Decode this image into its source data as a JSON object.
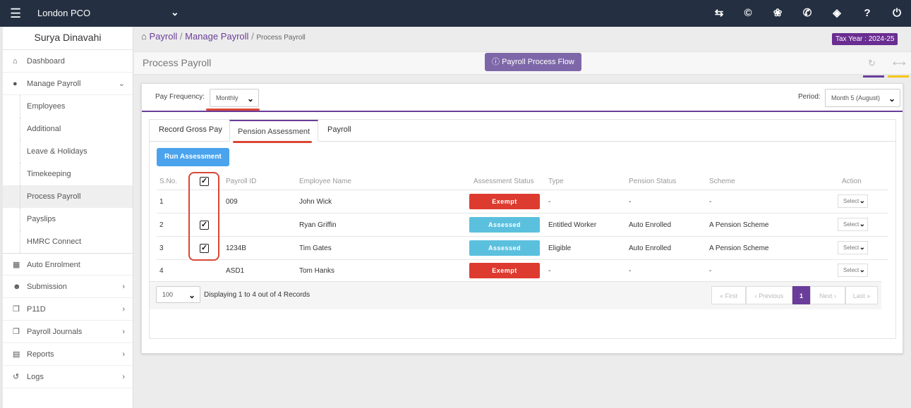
{
  "topbar": {
    "company": "London PCO",
    "icons": [
      "menu-icon",
      "chevron-down-icon",
      "transfer-icon",
      "copyright-icon",
      "cubes-icon",
      "bullhorn-icon",
      "ticket-icon",
      "help-icon",
      "power-icon"
    ],
    "help_label": "?"
  },
  "sidebar": {
    "user": "Surya Dinavahi",
    "items": [
      {
        "label": "Dashboard",
        "icon": "home-icon"
      },
      {
        "label": "Manage Payroll",
        "icon": "user-icon"
      },
      {
        "label": "Auto Enrolment",
        "icon": "grid-icon"
      },
      {
        "label": "Submission",
        "icon": "users-icon"
      },
      {
        "label": "P11D",
        "icon": "copy-icon"
      },
      {
        "label": "Payroll Journals",
        "icon": "copy-icon"
      },
      {
        "label": "Reports",
        "icon": "file-icon"
      },
      {
        "label": "Logs",
        "icon": "history-icon"
      }
    ],
    "subitems": [
      "Employees",
      "Additional",
      "Leave & Holidays",
      "Timekeeping",
      "Process Payroll",
      "Payslips",
      "HMRC Connect"
    ]
  },
  "breadcrumb": {
    "home": "Payroll",
    "section": "Manage Payroll",
    "current": "Process Payroll",
    "sep": "/"
  },
  "tax_year": "Tax Year : 2024-25",
  "page_title": "Process Payroll",
  "flow_button": "Payroll Process Flow",
  "filters": {
    "pay_frequency_label": "Pay Frequency:",
    "pay_frequency_value": "Monthly",
    "period_label": "Period:",
    "period_value": "Month 5 (August)"
  },
  "tabs": [
    "Record Gross Pay",
    "Pension Assessment",
    "Payroll"
  ],
  "run_button": "Run Assessment",
  "table": {
    "headers": [
      "S.No.",
      "Payroll ID",
      "Employee Name",
      "Assessment Status",
      "Type",
      "Pension Status",
      "Scheme",
      "Action"
    ],
    "rows": [
      {
        "sno": "1",
        "checked": false,
        "payroll_id": "009",
        "name": "John Wick",
        "status": "Exempt",
        "type": "-",
        "pension_status": "-",
        "scheme": "-",
        "action": "Select"
      },
      {
        "sno": "2",
        "checked": true,
        "payroll_id": "",
        "name": "Ryan Griffin",
        "status": "Assessed",
        "type": "Entitled Worker",
        "pension_status": "Auto Enrolled",
        "scheme": "A Pension Scheme",
        "action": "Select"
      },
      {
        "sno": "3",
        "checked": true,
        "payroll_id": "1234B",
        "name": "Tim Gates",
        "status": "Assessed",
        "type": "Eligible",
        "pension_status": "Auto Enrolled",
        "scheme": "A Pension Scheme",
        "action": "Select"
      },
      {
        "sno": "4",
        "checked": false,
        "payroll_id": "ASD1",
        "name": "Tom Hanks",
        "status": "Exempt",
        "type": "-",
        "pension_status": "-",
        "scheme": "-",
        "action": "Select"
      }
    ],
    "header_checked": true
  },
  "pagination": {
    "page_size": "100",
    "info": "Displaying 1 to 4 out of 4 Records",
    "first": "« First",
    "previous": "‹ Previous",
    "current": "1",
    "next": "Next ›",
    "last": "Last »"
  },
  "colors": {
    "topbar": "#243041",
    "accent": "#6a3d9a",
    "exempt": "#dd3b2f",
    "assessed": "#5bc0de",
    "highlight": "#d94735",
    "run": "#4aa3ec"
  }
}
